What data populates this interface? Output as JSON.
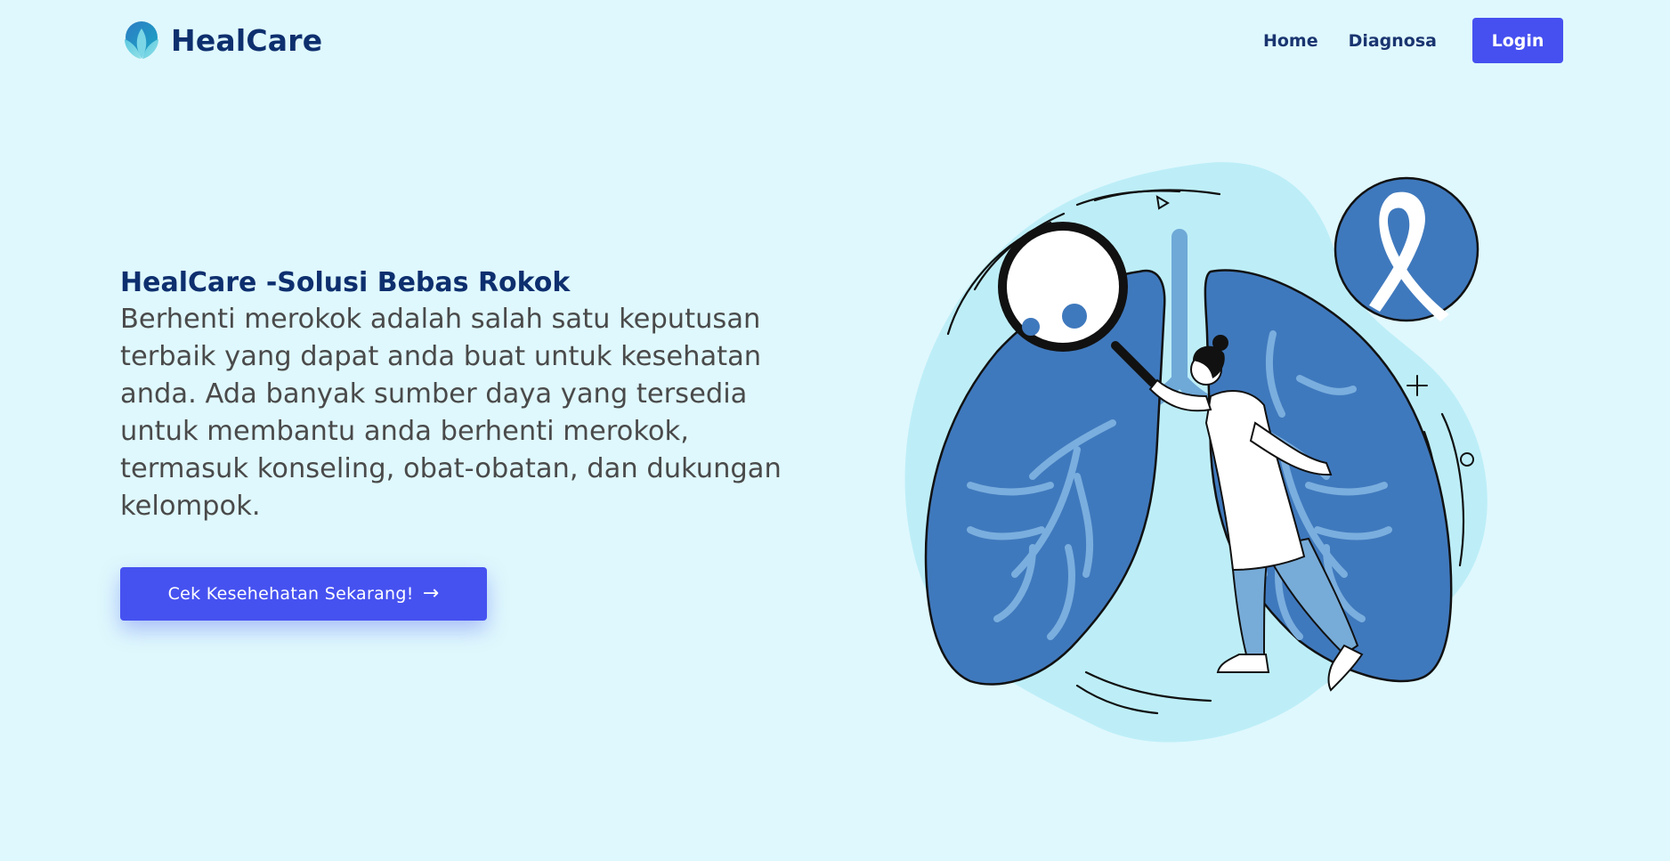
{
  "navbar": {
    "brand_name": "HealCare",
    "logo_icon": "leaf-drop-logo",
    "links": [
      {
        "label": "Home"
      },
      {
        "label": "Diagnosa"
      }
    ],
    "login_label": "Login"
  },
  "hero": {
    "title": "HealCare -Solusi Bebas Rokok",
    "description": "Berhenti merokok adalah salah satu keputusan terbaik yang dapat anda buat untuk kesehatan anda. Ada banyak sumber daya yang tersedia untuk membantu anda berhenti merokok, termasuk konseling, obat-obatan, dan dukungan kelompok.",
    "cta_label": "Cek Kesehehatan Sekarang!",
    "cta_icon": "arrow-right-icon"
  },
  "illustration": {
    "subject": "doctor-examining-lungs-illustration",
    "icons": [
      "lungs-icon",
      "magnifying-glass-icon",
      "virus-icon",
      "awareness-ribbon-icon",
      "sparkle-icon"
    ]
  },
  "colors": {
    "background": "#dff8fd",
    "brand_dark": "#0e2f6e",
    "accent_button": "#4650f0",
    "text_body": "#4a4a4a",
    "lung_blue": "#3f79bd",
    "blob": "#bdeef8"
  }
}
